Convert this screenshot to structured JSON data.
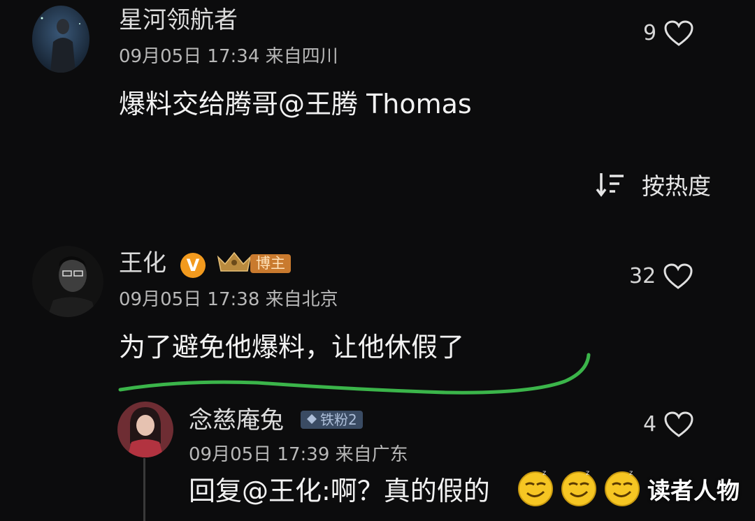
{
  "comments": [
    {
      "username": "星河领航者",
      "meta": "09月05日 17:34 来自四川",
      "text": "爆料交给腾哥@王腾 Thomas",
      "likes": "9"
    },
    {
      "username": "王化",
      "badge_text": "博主",
      "meta": "09月05日 17:38 来自北京",
      "text": "为了避免他爆料，让他休假了",
      "likes": "32"
    },
    {
      "username": "念慈庵兔",
      "badge_text": "铁粉2",
      "meta": "09月05日 17:39 来自广东",
      "text": "回复@王化:啊？真的假的",
      "likes": "4"
    }
  ],
  "sort": {
    "label": "按热度",
    "icon": "sort-descending-icon"
  },
  "watermark": "读者人物",
  "colors": {
    "background": "#0c0c0d",
    "underline": "#3bb54a",
    "verified": "#f29a1e"
  }
}
